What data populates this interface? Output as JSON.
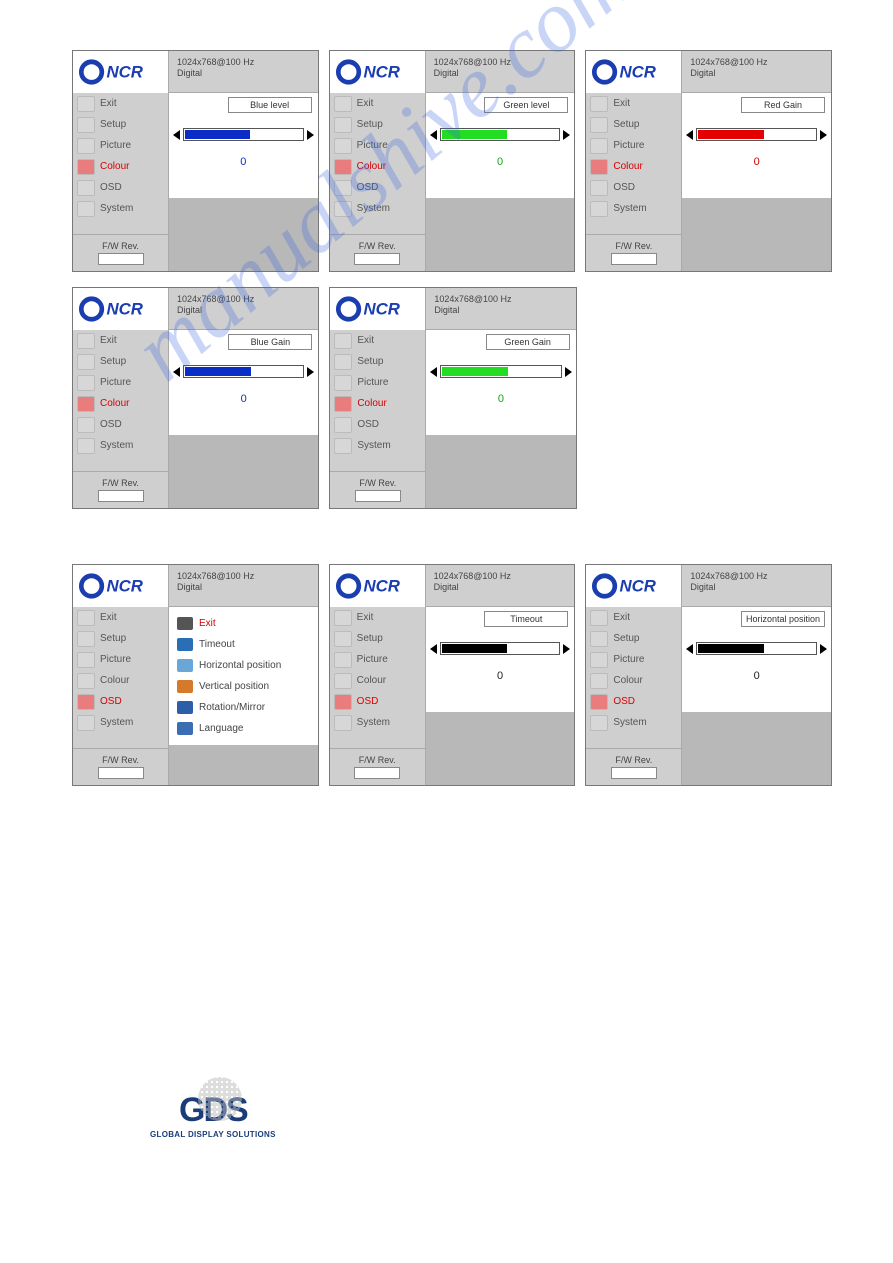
{
  "watermark": "manualshive.com",
  "footer_logo": {
    "text": "GDS",
    "sub": "GLOBAL DISPLAY SOLUTIONS"
  },
  "header": {
    "resolution": "1024x768@100 Hz",
    "signal": "Digital"
  },
  "sidebar_items": [
    "Exit",
    "Setup",
    "Picture",
    "Colour",
    "OSD",
    "System"
  ],
  "fw_label": "F/W Rev.",
  "panels": [
    {
      "title": "Blue level",
      "value": "0",
      "value_color": "#0a2cc7",
      "bar_color": "#0a2cc7",
      "active": "Colour",
      "type": "slider"
    },
    {
      "title": "Green level",
      "value": "0",
      "value_color": "#17a317",
      "bar_color": "#22dd22",
      "active": "Colour",
      "type": "slider"
    },
    {
      "title": "Red Gain",
      "value": "0",
      "value_color": "#cc0000",
      "bar_color": "#e40000",
      "active": "Colour",
      "type": "slider"
    },
    {
      "title": "Blue Gain",
      "value": "0",
      "value_color": "#0a2cc7",
      "bar_color": "#0a2cc7",
      "active": "Colour",
      "type": "slider"
    },
    {
      "title": "Green Gain",
      "value": "0",
      "value_color": "#17a317",
      "bar_color": "#22dd22",
      "active": "Colour",
      "type": "slider"
    },
    {
      "type": "empty"
    },
    {
      "type": "submenu",
      "active": "OSD",
      "submenu": [
        {
          "label": "Exit",
          "color": "#d80000",
          "icon": "#555"
        },
        {
          "label": "Timeout",
          "color": "#444",
          "icon": "#2a6fb5"
        },
        {
          "label": "Horizontal position",
          "color": "#444",
          "icon": "#6aa6d8"
        },
        {
          "label": "Vertical position",
          "color": "#444",
          "icon": "#d47a2a"
        },
        {
          "label": "Rotation/Mirror",
          "color": "#444",
          "icon": "#2d5ea8"
        },
        {
          "label": "Language",
          "color": "#444",
          "icon": "#3a6db3"
        }
      ]
    },
    {
      "title": "Timeout",
      "value": "0",
      "value_color": "#222",
      "bar_color": "#000",
      "active": "OSD",
      "type": "slider"
    },
    {
      "title": "Horizontal position",
      "value": "0",
      "value_color": "#222",
      "bar_color": "#000",
      "active": "OSD",
      "type": "slider"
    }
  ]
}
